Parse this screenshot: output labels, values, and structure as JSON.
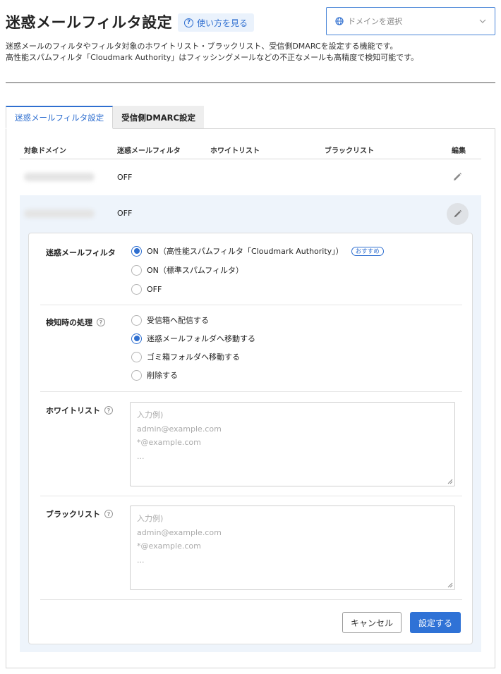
{
  "header": {
    "title": "迷惑メールフィルタ設定",
    "help_label": "使い方を見る",
    "domain_select_placeholder": "ドメインを選択",
    "description_line1": "迷惑メールのフィルタやフィルタ対象のホワイトリスト・ブラックリスト、受信側DMARCを設定する機能です。",
    "description_line2": "高性能スパムフィルタ「Cloudmark Authority」はフィッシングメールなどの不正なメールも高精度で検知可能です。"
  },
  "tabs": [
    {
      "label": "迷惑メールフィルタ設定",
      "active": true
    },
    {
      "label": "受信側DMARC設定",
      "active": false
    }
  ],
  "table": {
    "columns": [
      "対象ドメイン",
      "迷惑メールフィルタ",
      "ホワイトリスト",
      "ブラックリスト",
      "編集"
    ],
    "rows": [
      {
        "domain": "",
        "filter": "OFF"
      },
      {
        "domain": "",
        "filter": "OFF"
      }
    ]
  },
  "form": {
    "filter": {
      "label": "迷惑メールフィルタ",
      "options": [
        "ON（高性能スパムフィルタ「Cloudmark Authority」）",
        "ON（標準スパムフィルタ）",
        "OFF"
      ],
      "recommended_badge": "おすすめ",
      "selected_index": 0
    },
    "action": {
      "label": "検知時の処理",
      "options": [
        "受信箱へ配信する",
        "迷惑メールフォルダへ移動する",
        "ゴミ箱フォルダへ移動する",
        "削除する"
      ],
      "selected_index": 1
    },
    "whitelist": {
      "label": "ホワイトリスト",
      "placeholder": [
        "入力例)",
        "admin@example.com",
        "*@example.com",
        "..."
      ]
    },
    "blacklist": {
      "label": "ブラックリスト",
      "placeholder": [
        "入力例)",
        "admin@example.com",
        "*@example.com",
        "..."
      ]
    },
    "cancel_label": "キャンセル",
    "submit_label": "設定する"
  },
  "colors": {
    "accent": "#2f6fd0",
    "expanded_bg": "#eef4fb"
  }
}
